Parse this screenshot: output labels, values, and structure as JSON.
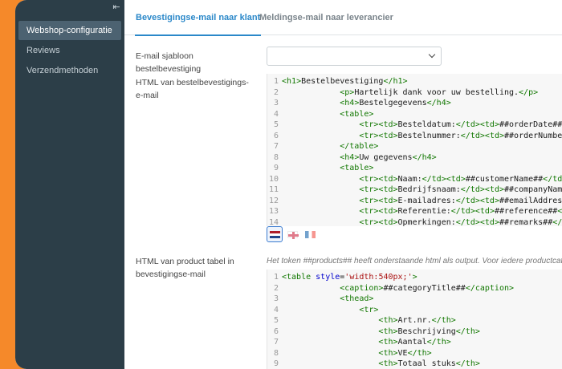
{
  "sidebar": {
    "collapse_glyph": "⇤",
    "items": [
      {
        "label": "Webshop-configuratie",
        "active": true
      },
      {
        "label": "Reviews",
        "active": false
      },
      {
        "label": "Verzendmethoden",
        "active": false
      }
    ]
  },
  "tabs": [
    {
      "label": "Bevestigingse-mail naar klant",
      "active": true
    },
    {
      "label": "Meldingse-mail naar leverancier",
      "active": false
    }
  ],
  "form": {
    "template_label": "E-mail sjabloon bestelbevestiging",
    "template_value": "",
    "html_label": "HTML van bestelbevestigings­e-mail",
    "product_label": "HTML van product tabel in bevestigingse-mail",
    "product_hint": "Het token ##products## heeft onderstaande html als output. Voor iedere productcategorie"
  },
  "editor_html": {
    "lines": [
      {
        "n": "1",
        "indent": "",
        "code": "<h1>Bestelbevestiging</h1>"
      },
      {
        "n": "2",
        "indent": "            ",
        "code": "<p>Hartelijk dank voor uw bestelling.</p>"
      },
      {
        "n": "3",
        "indent": "            ",
        "code": "<h4>Bestelgegevens</h4>"
      },
      {
        "n": "4",
        "indent": "            ",
        "code": "<table>"
      },
      {
        "n": "5",
        "indent": "                ",
        "code": "<tr><td>Besteldatum:</td><td>##orderDate##</td></tr>"
      },
      {
        "n": "6",
        "indent": "                ",
        "code": "<tr><td>Bestelnummer:</td><td>##orderNumber##</td></tr>"
      },
      {
        "n": "7",
        "indent": "            ",
        "code": "</table>"
      },
      {
        "n": "8",
        "indent": "            ",
        "code": "<h4>Uw gegevens</h4>"
      },
      {
        "n": "9",
        "indent": "            ",
        "code": "<table>"
      },
      {
        "n": "10",
        "indent": "                ",
        "code": "<tr><td>Naam:</td><td>##customerName##</td></tr>"
      },
      {
        "n": "11",
        "indent": "                ",
        "code": "<tr><td>Bedrijfsnaam:</td><td>##companyName##</td></tr>"
      },
      {
        "n": "12",
        "indent": "                ",
        "code": "<tr><td>E-mailadres:</td><td>##emailAddress##</td></tr>"
      },
      {
        "n": "13",
        "indent": "                ",
        "code": "<tr><td>Referentie:</td><td>##reference##</td></tr>"
      },
      {
        "n": "14",
        "indent": "                ",
        "code": "<tr><td>Opmerkingen:</td><td>##remarks##</td></tr>"
      }
    ]
  },
  "languages": [
    {
      "name": "nl-flag-icon",
      "active": true
    },
    {
      "name": "uk-flag-icon",
      "active": false
    },
    {
      "name": "fr-flag-icon",
      "active": false
    }
  ],
  "editor_product": {
    "lines": [
      {
        "n": "1",
        "indent": "",
        "code": "<table style='width:540px;'>"
      },
      {
        "n": "2",
        "indent": "            ",
        "code": "<caption>##categoryTitle##</caption>"
      },
      {
        "n": "3",
        "indent": "            ",
        "code": "<thead>"
      },
      {
        "n": "4",
        "indent": "                ",
        "code": "<tr>"
      },
      {
        "n": "5",
        "indent": "                    ",
        "code": "<th>Art.nr.</th>"
      },
      {
        "n": "6",
        "indent": "                    ",
        "code": "<th>Beschrijving</th>"
      },
      {
        "n": "7",
        "indent": "                    ",
        "code": "<th>Aantal</th>"
      },
      {
        "n": "8",
        "indent": "                    ",
        "code": "<th>VE</th>"
      },
      {
        "n": "9",
        "indent": "                    ",
        "code": "<th>Totaal stuks</th>"
      }
    ]
  }
}
